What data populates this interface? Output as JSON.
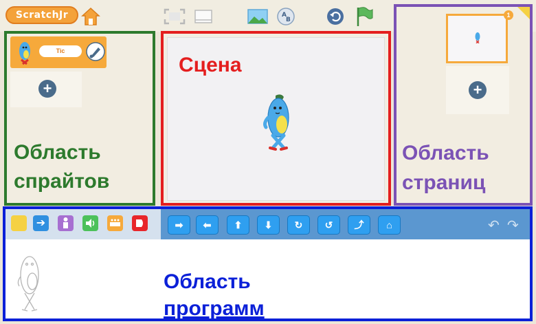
{
  "app": {
    "logo_text": "ScratchJr"
  },
  "toolbar": {
    "icons": [
      "home-icon",
      "fullscreen-icon",
      "grid-icon",
      "background-icon",
      "text-icon",
      "reset-icon",
      "green-flag-icon"
    ]
  },
  "sprites_area": {
    "label_line1": "Область",
    "label_line2": "спрайтов",
    "sprite_name": "Tic",
    "add_symbol": "+"
  },
  "stage_area": {
    "label": "Сцена"
  },
  "pages_area": {
    "label_line1": "Область",
    "label_line2": "страниц",
    "page_number": "1",
    "add_symbol": "+"
  },
  "program_area": {
    "label_line1": "Область",
    "label_line2": "программ",
    "categories": [
      "triggering-category",
      "motion-category",
      "looks-category",
      "sound-category",
      "control-category",
      "end-category"
    ],
    "blocks": [
      "move-right-block",
      "move-left-block",
      "move-up-block",
      "move-down-block",
      "turn-right-block",
      "turn-left-block",
      "hop-block",
      "go-home-block"
    ],
    "block_glyphs": [
      "➡",
      "⬅",
      "⬆",
      "⬇",
      "↻",
      "↺",
      "⤴",
      "⌂"
    ]
  },
  "colors": {
    "sprites_border": "#2d7a2d",
    "stage_border": "#e41e1e",
    "pages_border": "#7b52b5",
    "program_border": "#0b20d8",
    "selected_orange": "#f6a93b",
    "block_blue": "#2f9ff0"
  }
}
